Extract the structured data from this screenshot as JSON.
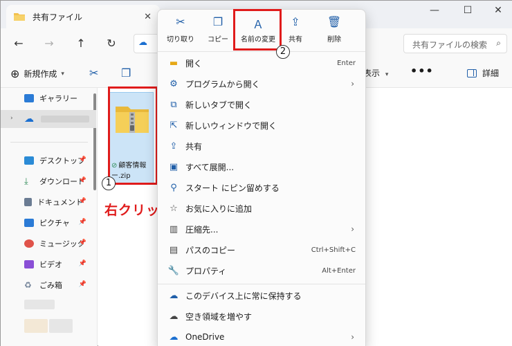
{
  "window": {
    "tab_title": "共有ファイル",
    "tab_close": "✕",
    "minimize": "—",
    "maximize": "☐",
    "close": "✕"
  },
  "address": {
    "search_placeholder": "共有ファイルの検索"
  },
  "commandbar": {
    "new_label": "新規作成",
    "view_label": "表示",
    "more_label": "•••",
    "details_label": "詳細"
  },
  "sidebar": {
    "items": [
      {
        "label": "ギャラリー",
        "icon": "gallery-icon",
        "color": "#2b7bd6"
      },
      {
        "label": "",
        "icon": "onedrive-icon",
        "color": "#1b6fd0"
      },
      {
        "label": "デスクトップ",
        "icon": "desktop-icon",
        "color": "#2b8bd6",
        "pinned": true
      },
      {
        "label": "ダウンロード",
        "icon": "download-icon",
        "color": "#2e8b57",
        "pinned": true
      },
      {
        "label": "ドキュメント",
        "icon": "document-icon",
        "color": "#6b7c93",
        "pinned": true
      },
      {
        "label": "ピクチャ",
        "icon": "pictures-icon",
        "color": "#2b7bd6",
        "pinned": true
      },
      {
        "label": "ミュージック",
        "icon": "music-icon",
        "color": "#e0534a",
        "pinned": true
      },
      {
        "label": "ビデオ",
        "icon": "video-icon",
        "color": "#8a4fd6",
        "pinned": true
      },
      {
        "label": "ごみ箱",
        "icon": "recycle-bin-icon",
        "color": "#6b7c93",
        "pinned": true
      }
    ]
  },
  "file": {
    "name_line1": "顧客情報",
    "name_line2": "ー.zip"
  },
  "annotations": {
    "step1": "1",
    "step2": "2",
    "right_click_text": "右クリック"
  },
  "context_menu": {
    "top_actions": [
      {
        "label": "切り取り",
        "icon": "cut-icon"
      },
      {
        "label": "コピー",
        "icon": "copy-icon"
      },
      {
        "label": "名前の変更",
        "icon": "rename-icon"
      },
      {
        "label": "共有",
        "icon": "share-icon"
      },
      {
        "label": "削除",
        "icon": "delete-icon"
      }
    ],
    "items": [
      {
        "label": "開く",
        "shortcut": "Enter",
        "icon": "open-folder-icon"
      },
      {
        "label": "プログラムから開く",
        "shortcut": "",
        "icon": "open-with-icon",
        "submenu": true
      },
      {
        "label": "新しいタブで開く",
        "shortcut": "",
        "icon": "new-tab-icon"
      },
      {
        "label": "新しいウィンドウで開く",
        "shortcut": "",
        "icon": "new-window-icon"
      },
      {
        "label": "共有",
        "shortcut": "",
        "icon": "share-icon"
      },
      {
        "label": "すべて展開...",
        "shortcut": "",
        "icon": "extract-icon"
      },
      {
        "label": "スタート にピン留めする",
        "shortcut": "",
        "icon": "pin-icon"
      },
      {
        "label": "お気に入りに追加",
        "shortcut": "",
        "icon": "star-icon"
      },
      {
        "label": "圧縮先...",
        "shortcut": "",
        "icon": "compress-icon",
        "submenu": true
      },
      {
        "label": "パスのコピー",
        "shortcut": "Ctrl+Shift+C",
        "icon": "copy-path-icon"
      },
      {
        "label": "プロパティ",
        "shortcut": "Alt+Enter",
        "icon": "properties-icon"
      },
      {
        "label": "このデバイス上に常に保持する",
        "shortcut": "",
        "icon": "keep-on-device-icon"
      },
      {
        "label": "空き領域を増やす",
        "shortcut": "",
        "icon": "free-space-icon"
      },
      {
        "label": "OneDrive",
        "shortcut": "",
        "icon": "onedrive-icon",
        "submenu": true
      }
    ]
  }
}
